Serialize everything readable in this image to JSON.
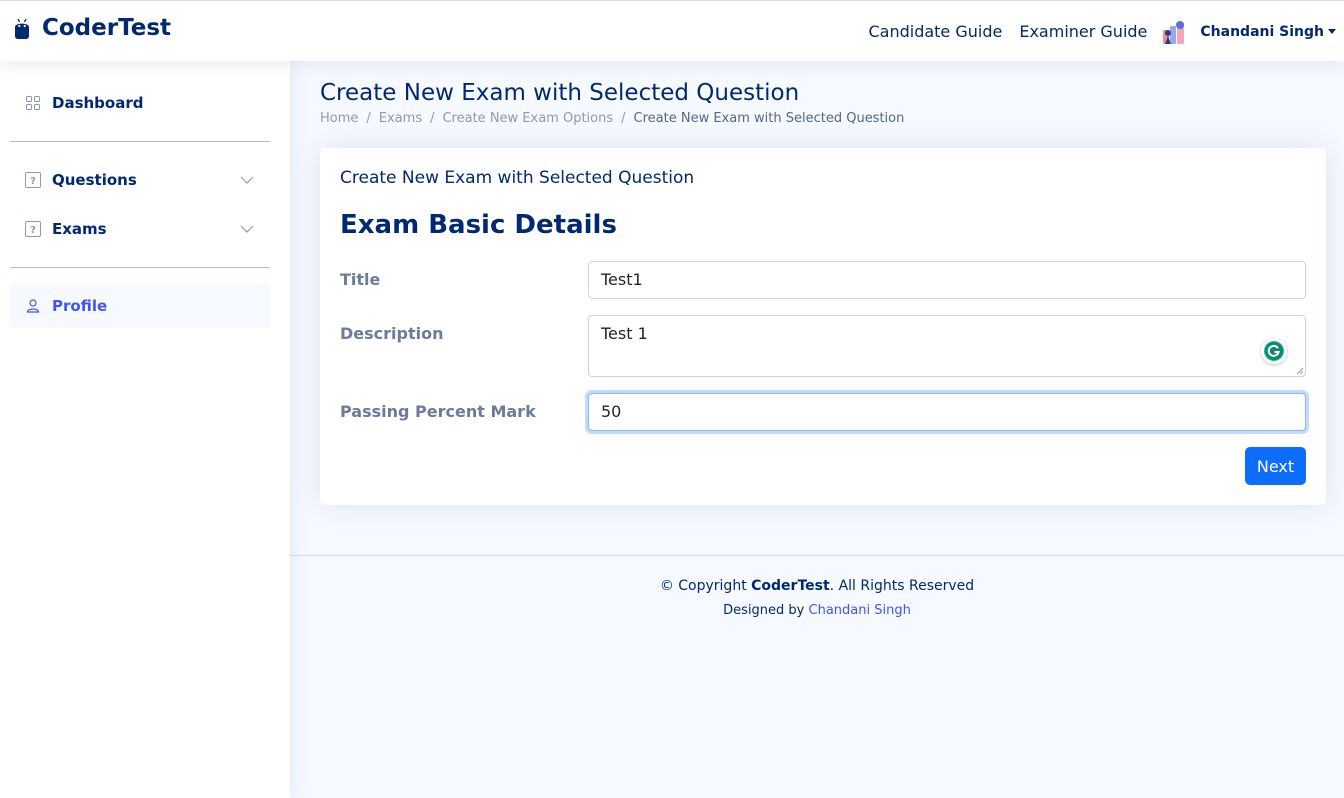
{
  "header": {
    "brand": "CoderTest",
    "links": [
      "Candidate Guide",
      "Examiner Guide"
    ],
    "user_name": "Chandani Singh"
  },
  "sidebar": {
    "items": [
      {
        "label": "Dashboard",
        "icon": "grid-icon"
      },
      {
        "label": "Questions",
        "icon": "question-square-icon"
      },
      {
        "label": "Exams",
        "icon": "question-square-icon"
      },
      {
        "label": "Profile",
        "icon": "person-icon"
      }
    ]
  },
  "page": {
    "title": "Create New Exam with Selected Question",
    "breadcrumb": [
      "Home",
      "Exams",
      "Create New Exam Options",
      "Create New Exam with Selected Question"
    ]
  },
  "card": {
    "title": "Create New Exam with Selected Question",
    "section_heading": "Exam Basic Details",
    "fields": {
      "title": {
        "label": "Title",
        "value": "Test1"
      },
      "description": {
        "label": "Description",
        "value": "Test 1"
      },
      "passing": {
        "label": "Passing Percent Mark",
        "value": "50"
      }
    },
    "next_label": "Next"
  },
  "footer": {
    "copyright_prefix": "© Copyright ",
    "copyright_brand": "CoderTest",
    "copyright_suffix": ". All Rights Reserved",
    "designed_by": "Designed by ",
    "author": "Chandani Singh"
  },
  "colors": {
    "accent": "#4154f1",
    "navy": "#012970",
    "primary_button": "#0d6efd",
    "grammarly": "#15c39a"
  }
}
